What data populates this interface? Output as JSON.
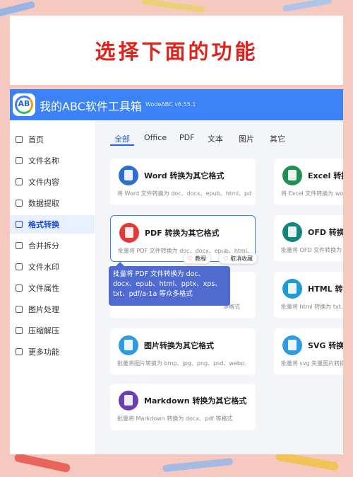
{
  "headline": "选择下面的功能",
  "app": {
    "title": "我的ABC软件工具箱",
    "version": "WodeABC v6.55.1",
    "logo_text": "AB"
  },
  "sidebar": {
    "items": [
      {
        "label": "首页",
        "icon": "home-icon"
      },
      {
        "label": "文件名称",
        "icon": "file-name-icon"
      },
      {
        "label": "文件内容",
        "icon": "file-content-icon"
      },
      {
        "label": "数据提取",
        "icon": "data-extract-icon"
      },
      {
        "label": "格式转换",
        "icon": "format-convert-icon",
        "active": true
      },
      {
        "label": "合并拆分",
        "icon": "merge-split-icon"
      },
      {
        "label": "文件水印",
        "icon": "watermark-icon"
      },
      {
        "label": "文件属性",
        "icon": "file-properties-icon"
      },
      {
        "label": "图片处理",
        "icon": "image-process-icon"
      },
      {
        "label": "压缩解压",
        "icon": "compress-icon"
      },
      {
        "label": "更多功能",
        "icon": "more-functions-icon"
      }
    ]
  },
  "tabs": [
    "全部",
    "Office",
    "PDF",
    "文本",
    "图片",
    "其它"
  ],
  "cards": [
    {
      "title": "Word 转换为其它格式",
      "desc": "将 Word 文件转换为 doc、docx、epub、html、pd",
      "color": "#2b6fd6"
    },
    {
      "title": "Excel 转换为其它格式",
      "desc": "将 Excel 文件转换为 word、",
      "color": "#1f8f52"
    },
    {
      "title": "PDF 转换为其它格式",
      "desc": "批量将 PDF 文件转换为 doc、docx、epub、html、",
      "color": "#e53935"
    },
    {
      "title": "OFD 转换为其它格式",
      "desc": "批量将 OFD 文件转换为 pdf",
      "color": "#14857a"
    },
    {
      "title": "",
      "desc": "多格式",
      "color": "#ffffff"
    },
    {
      "title": "HTML 转换为其它格式",
      "desc": "批量将 html 转换为 txt、do",
      "color": "#1e9ad6"
    },
    {
      "title": "图片转换为其它格式",
      "desc": "批量将图片转换为 bmp、jpg、png、psd、webp.",
      "color": "#2c9be0"
    },
    {
      "title": "SVG 转换为其它格式",
      "desc": "批量将 svg 矢量图片转换为",
      "color": "#2c9be0"
    },
    {
      "title": "Markdown 转换为其它格式",
      "desc": "批量将 Markdown 转换为 docx、pdf 等格式",
      "color": "#6b3fb0"
    }
  ],
  "pills": {
    "tutorial": "教程",
    "unfavorite": "取消收藏"
  },
  "tooltip": "批量将 PDF 文件转换为 doc、docx、epub、html、pptx、xps、txt、pdf/a-1a 等众多格式"
}
